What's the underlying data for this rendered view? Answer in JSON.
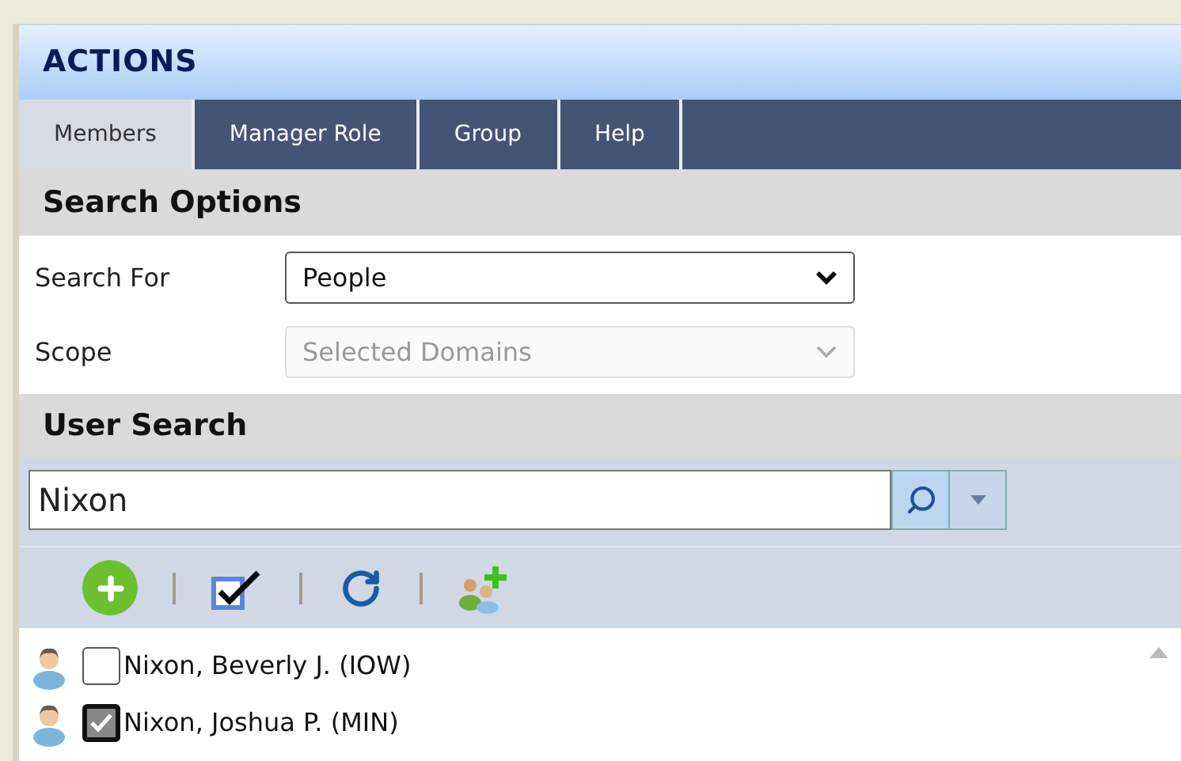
{
  "panel": {
    "title": "ACTIONS"
  },
  "tabs": [
    {
      "label": "Members",
      "selected": true
    },
    {
      "label": "Manager Role",
      "selected": false
    },
    {
      "label": "Group",
      "selected": false
    },
    {
      "label": "Help",
      "selected": false
    }
  ],
  "search_options": {
    "title": "Search Options",
    "fields": [
      {
        "label": "Search For",
        "value": "People",
        "disabled": false
      },
      {
        "label": "Scope",
        "value": "Selected Domains",
        "disabled": true
      }
    ]
  },
  "user_search": {
    "title": "User Search",
    "query": "Nixon"
  },
  "results": [
    {
      "name": "Nixon, Beverly J. (IOW)",
      "checked": false
    },
    {
      "name": "Nixon, Joshua P. (MIN)",
      "checked": true
    }
  ]
}
